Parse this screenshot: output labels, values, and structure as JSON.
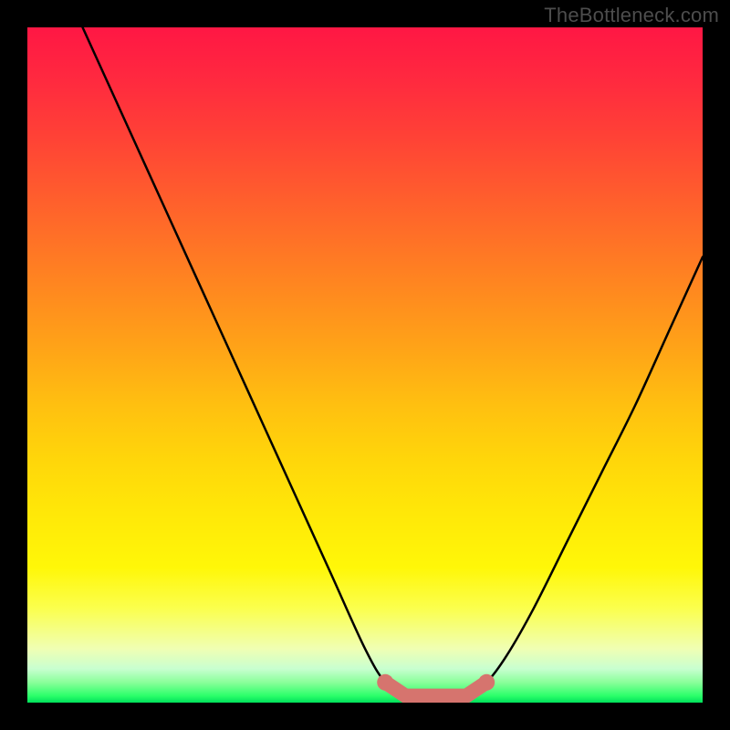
{
  "watermark": "TheBottleneck.com",
  "colors": {
    "background": "#000000",
    "curve": "#000000",
    "marker": "#d6746e"
  },
  "chart_data": {
    "type": "line",
    "title": "",
    "xlabel": "",
    "ylabel": "",
    "xlim": [
      0,
      100
    ],
    "ylim": [
      0,
      100
    ],
    "grid": false,
    "description": "Bottleneck curve: y-value is mismatch/bottleneck percentage vs an implicit x parameter; minimum (near 0) is optimal match, shown over a red-to-green vertical gradient.",
    "series": [
      {
        "name": "bottleneck-curve",
        "x": [
          0,
          5,
          10,
          15,
          20,
          25,
          30,
          35,
          40,
          45,
          50,
          53,
          56,
          59,
          62,
          65,
          68,
          71,
          75,
          80,
          85,
          90,
          95,
          100
        ],
        "y": [
          118,
          107,
          96,
          85,
          74,
          63,
          52,
          41,
          30,
          19,
          8,
          3,
          1,
          1,
          1,
          1,
          3,
          7,
          14,
          24,
          34,
          44,
          55,
          66
        ]
      }
    ],
    "markers": {
      "name": "optimal-range",
      "shape": "rounded",
      "x": [
        53,
        56,
        59,
        62,
        65,
        68
      ],
      "y": [
        3,
        1,
        1,
        1,
        1,
        3
      ],
      "color": "#d6746e"
    }
  }
}
